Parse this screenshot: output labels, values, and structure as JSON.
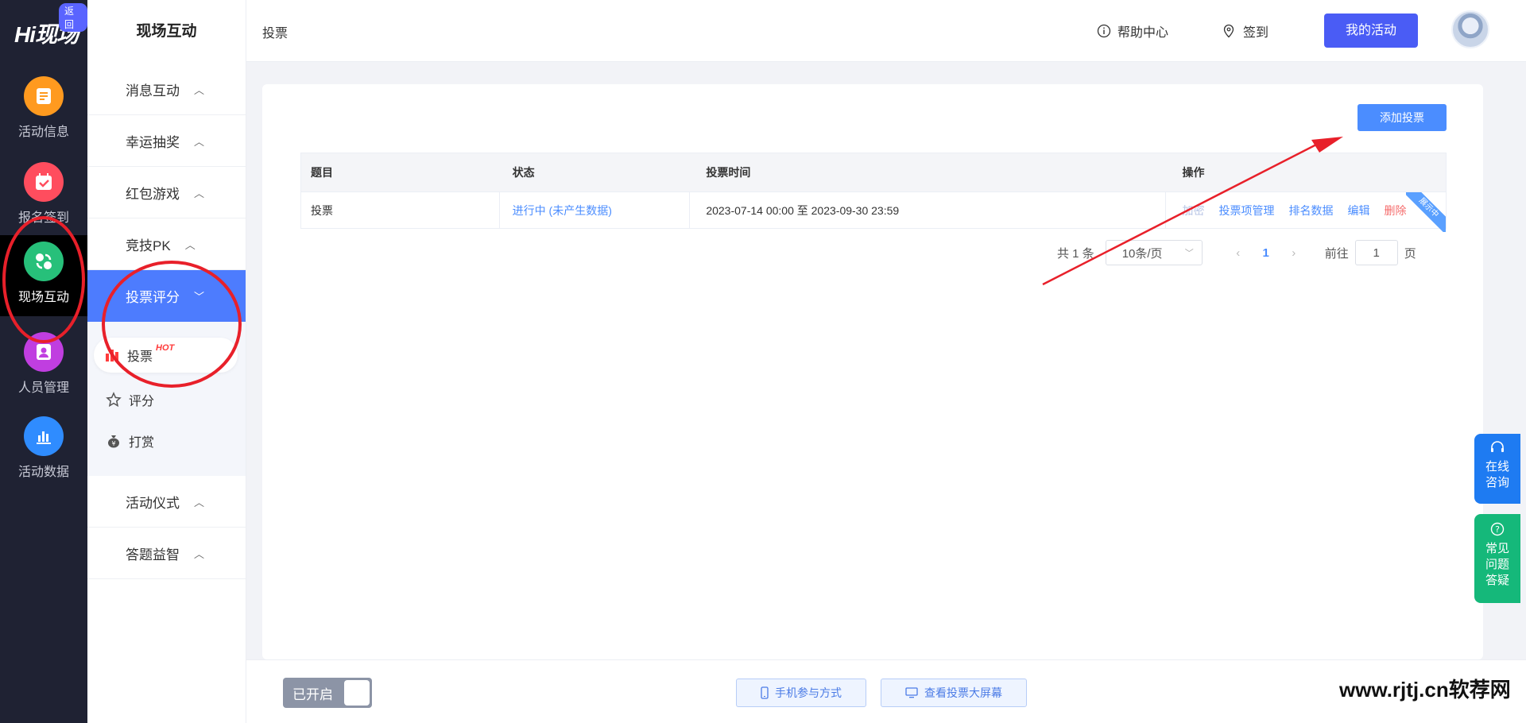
{
  "rail": {
    "logo_hi": "Hi",
    "logo_text": "现场",
    "back_label": "返回",
    "items": [
      {
        "label": "活动信息",
        "icon": "document-icon",
        "color": "#ff9a1f"
      },
      {
        "label": "报名签到",
        "icon": "calendar-check-icon",
        "color": "#ff4d5e"
      },
      {
        "label": "现场互动",
        "icon": "interaction-icon",
        "color": "#27c07a"
      },
      {
        "label": "人员管理",
        "icon": "user-badge-icon",
        "color": "#c03ee0"
      },
      {
        "label": "活动数据",
        "icon": "bar-chart-icon",
        "color": "#2f8cff"
      }
    ]
  },
  "submenu": {
    "title": "现场互动",
    "groups": [
      {
        "label": "消息互动"
      },
      {
        "label": "幸运抽奖"
      },
      {
        "label": "红包游戏"
      },
      {
        "label": "竞技PK"
      },
      {
        "label": "投票评分"
      },
      {
        "label": "活动仪式"
      },
      {
        "label": "答题益智"
      }
    ],
    "sub_items": [
      {
        "label": "投票",
        "badge": "HOT",
        "icon": "bar-chart-icon"
      },
      {
        "label": "评分",
        "icon": "star-icon"
      },
      {
        "label": "打赏",
        "icon": "money-bag-icon"
      }
    ]
  },
  "topbar": {
    "breadcrumb": "投票",
    "help": "帮助中心",
    "checkin": "签到",
    "my_activity": "我的活动"
  },
  "main": {
    "add_button": "添加投票",
    "table": {
      "headers": [
        "题目",
        "状态",
        "投票时间",
        "操作"
      ],
      "rows": [
        {
          "title": "投票",
          "status": "进行中 (未产生数据)",
          "time": "2023-07-14 00:00 至 2023-09-30 23:59",
          "ops": [
            "加密",
            "投票项管理",
            "排名数据",
            "编辑",
            "删除"
          ],
          "ribbon": "展示中"
        }
      ]
    },
    "pagination": {
      "total": "共 1 条",
      "page_size": "10条/页",
      "current_page": "1",
      "goto_prefix": "前往",
      "goto_value": "1",
      "goto_suffix": "页"
    }
  },
  "floating": {
    "consult_line1": "在线",
    "consult_line2": "咨询",
    "faq_line1": "常见",
    "faq_line2": "问题",
    "faq_line3": "答疑"
  },
  "bottombar": {
    "toggle_label": "已开启",
    "mobile_btn": "手机参与方式",
    "screen_btn": "查看投票大屏幕"
  },
  "watermark": {
    "url": "www.rjtj.cn",
    "name": "软荐网"
  },
  "colors": {
    "rail_bg": "#1f2233",
    "accent": "#4b8dff",
    "active_menu": "#4d7cfe",
    "my_activity_btn": "#4a5cf5",
    "danger": "#f56c6c",
    "annotation_red": "#e8202a"
  }
}
